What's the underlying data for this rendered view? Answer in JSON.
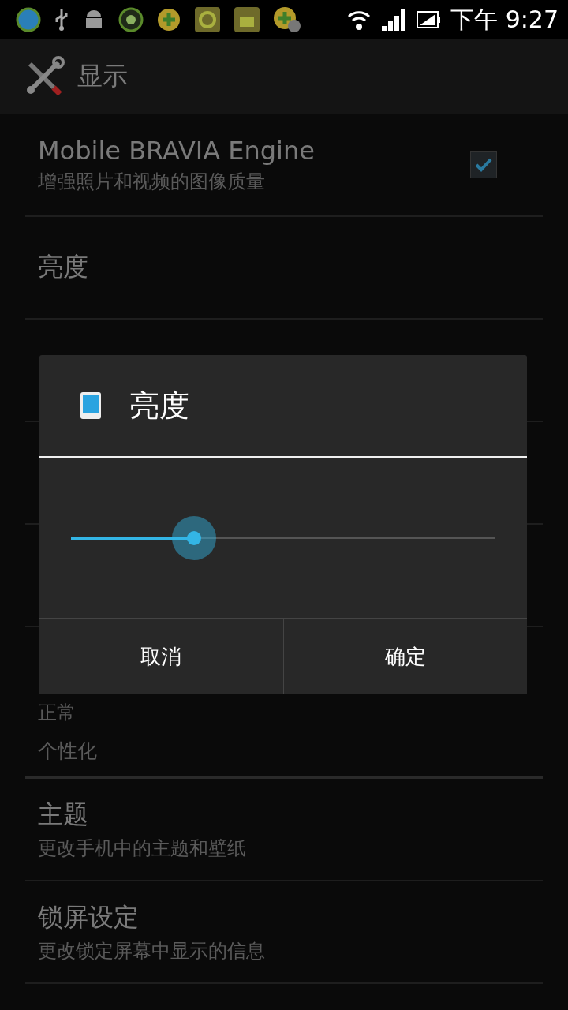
{
  "status_bar": {
    "time": "下午 9:27"
  },
  "action_bar": {
    "title": "显示"
  },
  "settings": [
    {
      "kind": "check",
      "title": "Mobile BRAVIA Engine",
      "summary": "增强照片和视频的图像质量",
      "checked": true
    },
    {
      "kind": "plain",
      "title": "亮度"
    },
    {
      "kind": "hidden"
    },
    {
      "kind": "hidden"
    },
    {
      "kind": "hidden"
    },
    {
      "kind": "summary_only",
      "summary": "正常"
    },
    {
      "kind": "category",
      "title": "个性化"
    },
    {
      "kind": "plain",
      "title": "主题",
      "summary": "更改手机中的主题和壁纸"
    },
    {
      "kind": "plain",
      "title": "锁屏设定",
      "summary": "更改锁定屏幕中显示的信息"
    }
  ],
  "dialog": {
    "title": "亮度",
    "slider": {
      "level": 0.29
    },
    "buttons": [
      "取消",
      "确定"
    ]
  }
}
